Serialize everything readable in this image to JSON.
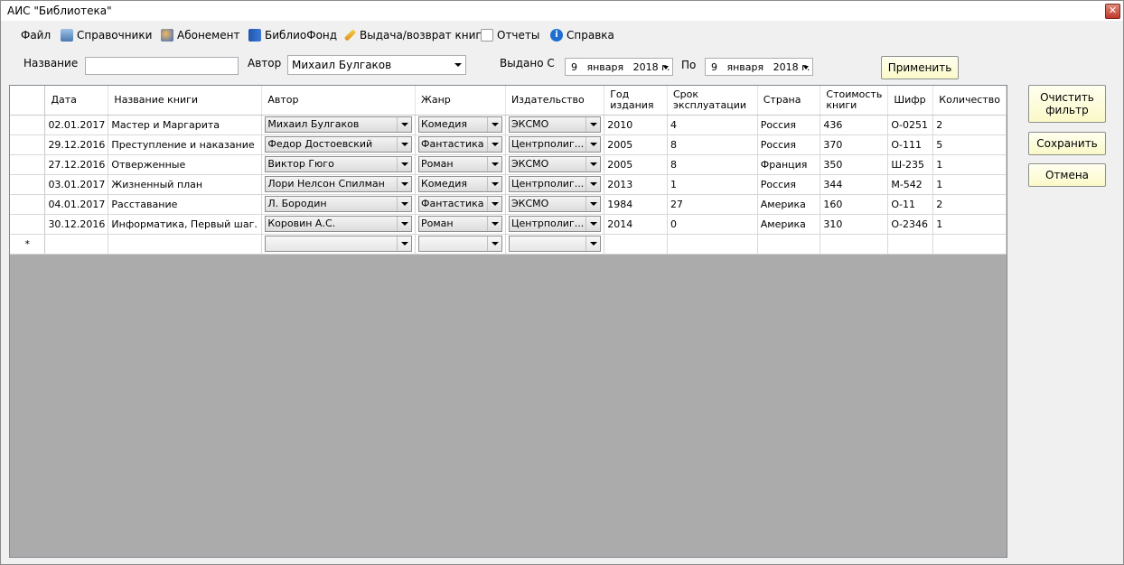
{
  "window": {
    "title": "АИС \"Библиотека\"",
    "close": "✕"
  },
  "menu": [
    {
      "label": "Файл",
      "icon": "none"
    },
    {
      "label": "Справочники",
      "icon": "book-icon"
    },
    {
      "label": "Абонемент",
      "icon": "users-icon"
    },
    {
      "label": "БиблиоФонд",
      "icon": "books-icon"
    },
    {
      "label": "Выдача/возврат книг",
      "icon": "pencil-icon"
    },
    {
      "label": "Отчеты",
      "icon": "report-icon"
    },
    {
      "label": "Справка",
      "icon": "info-icon"
    }
  ],
  "filter": {
    "title_label": "Название",
    "title_value": "",
    "author_label": "Автор",
    "author_value": "Михаил Булгаков",
    "issued_from_label": "Выдано С",
    "date_from": "9   января   2018 г.",
    "to_label": "По",
    "date_to": "9   января   2018 г.",
    "apply_label": "Применить"
  },
  "buttons": {
    "clear_filter": "Очистить фильтр",
    "save": "Сохранить",
    "cancel": "Отмена"
  },
  "table": {
    "columns": [
      "Дата",
      "Название книги",
      "Автор",
      "Жанр",
      "Издательство",
      "Год издания",
      "Срок эксплуатации",
      "Страна",
      "Стоимость книги",
      "Шифр",
      "Количество"
    ],
    "rows": [
      [
        "02.01.2017",
        "Мастер и Маргарита",
        "Михаил Булгаков",
        "Комедия",
        "ЭКСМО",
        "2010",
        "4",
        "Россия",
        "436",
        "О-0251",
        "2"
      ],
      [
        "29.12.2016",
        "Преступление и наказание",
        "Федор Достоевский",
        "Фантастика",
        "Центрполиг...",
        "2005",
        "8",
        "Россия",
        "370",
        "О-111",
        "5"
      ],
      [
        "27.12.2016",
        "Отверженные",
        "Виктор Гюго",
        "Роман",
        "ЭКСМО",
        "2005",
        "8",
        "Франция",
        "350",
        "Ш-235",
        "1"
      ],
      [
        "03.01.2017",
        "Жизненный план",
        "Лори Нелсон Спилман",
        "Комедия",
        "Центрполиг...",
        "2013",
        "1",
        "Россия",
        "344",
        "М-542",
        "1"
      ],
      [
        "04.01.2017",
        "Расставание",
        "Л. Бородин",
        "Фантастика",
        "ЭКСМО",
        "1984",
        "27",
        "Америка",
        "160",
        "О-11",
        "2"
      ],
      [
        "30.12.2016",
        "Информатика, Первый шаг.",
        "Коровин А.С.",
        "Роман",
        "Центрполиг...",
        "2014",
        "0",
        "Америка",
        "310",
        "О-2346",
        "1"
      ]
    ],
    "new_row_marker": "*"
  }
}
